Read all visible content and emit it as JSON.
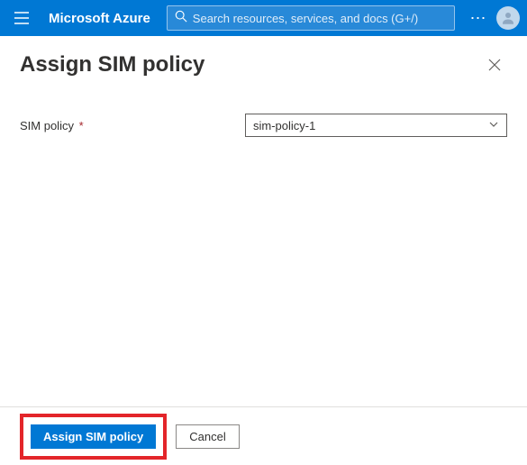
{
  "topbar": {
    "brand": "Microsoft Azure",
    "search_placeholder": "Search resources, services, and docs (G+/)"
  },
  "page": {
    "title": "Assign SIM policy"
  },
  "form": {
    "sim_policy_label": "SIM policy",
    "sim_policy_value": "sim-policy-1"
  },
  "footer": {
    "primary_label": "Assign SIM policy",
    "cancel_label": "Cancel"
  }
}
